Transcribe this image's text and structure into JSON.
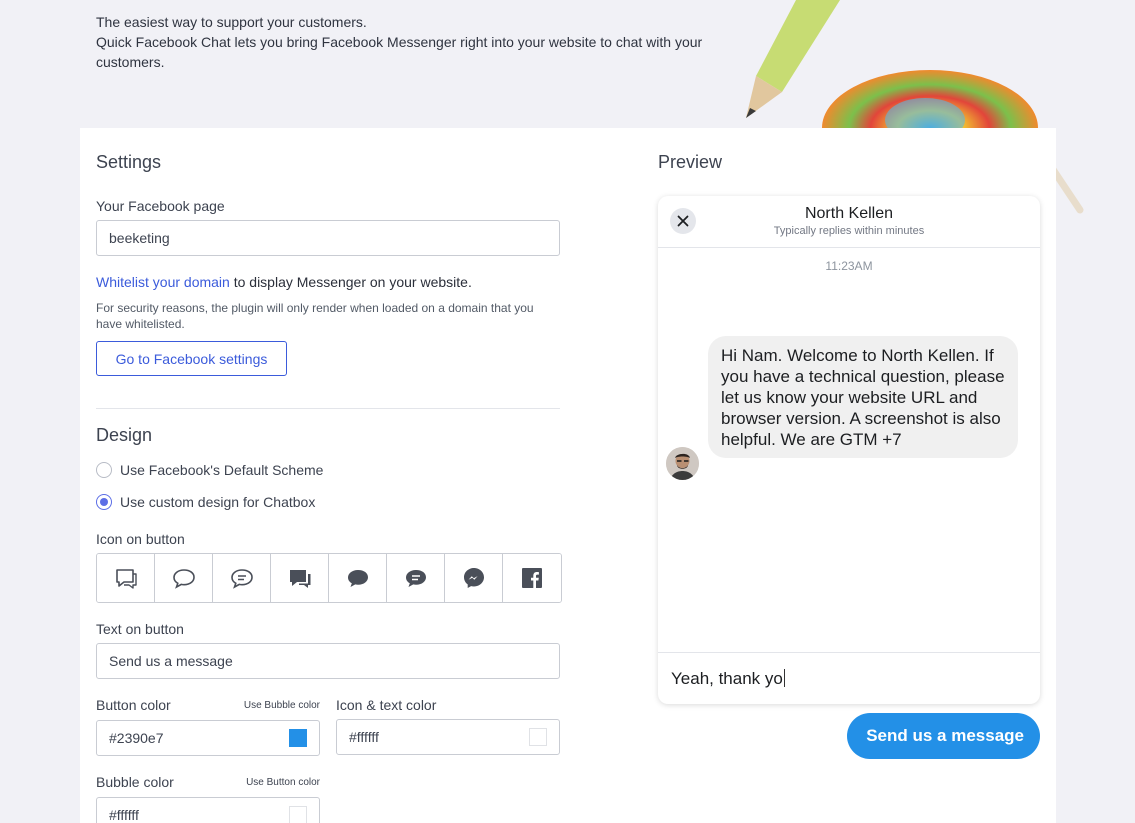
{
  "intro": {
    "line1": "The easiest way to support your customers.",
    "line2": "Quick Facebook Chat lets you bring Facebook Messenger right into your website to chat with your customers."
  },
  "settings": {
    "title": "Settings",
    "facebook_page_label": "Your Facebook page",
    "facebook_page_value": "beeketing",
    "whitelist_link": "Whitelist your domain",
    "whitelist_rest": " to display Messenger on your website.",
    "security_note": "For security reasons, the plugin will only render when loaded on a domain that you have whitelisted.",
    "go_button": "Go to Facebook settings"
  },
  "design": {
    "title": "Design",
    "options": [
      {
        "label": "Use Facebook's Default Scheme",
        "selected": false
      },
      {
        "label": "Use custom design for Chatbox",
        "selected": true
      }
    ],
    "icon_label": "Icon on button",
    "icons": [
      "chat-outline-icon",
      "chat-bubble-outline-icon",
      "chat-lines-outline-icon",
      "chat-filled-icon",
      "chat-bubble-filled-icon",
      "chat-lines-filled-icon",
      "messenger-icon",
      "facebook-icon"
    ],
    "text_label": "Text on button",
    "text_value": "Send us a message",
    "button_color_label": "Button color",
    "button_color_hint": "Use Bubble color",
    "button_color_value": "#2390e7",
    "icon_text_color_label": "Icon & text color",
    "icon_text_color_value": "#ffffff",
    "bubble_color_label": "Bubble color",
    "bubble_color_hint": "Use Button color",
    "bubble_color_value": "#ffffff"
  },
  "preview": {
    "title": "Preview",
    "chat_name": "North Kellen",
    "chat_sub": "Typically replies within minutes",
    "time": "11:23AM",
    "message": "Hi Nam. Welcome to North Kellen. If you have a technical question, please let us know your website URL and browser version. A screenshot is also helpful. We are GTM +7",
    "typed": "Yeah, thank yo",
    "send_button": "Send us a message"
  },
  "colors": {
    "accent": "#2390e7",
    "link": "#3b5bdb"
  }
}
